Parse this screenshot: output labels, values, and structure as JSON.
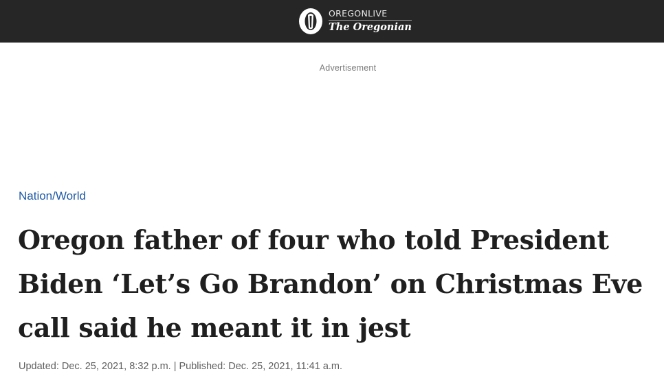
{
  "header": {
    "site_name": "OREGONLIVE",
    "paper_name": "The Oregonian",
    "logo_icon": "oregonian-o-icon",
    "background_color": "#262626"
  },
  "ad": {
    "label": "Advertisement"
  },
  "article": {
    "section": "Nation/World",
    "section_color": "#1e5aa6",
    "headline": "Oregon father of four who told President Biden ‘Let’s Go Brandon’ on Christmas Eve call said he meant it in jest",
    "dateline": "Updated: Dec. 25, 2021, 8:32 p.m. | Published: Dec. 25, 2021, 11:41 a.m."
  }
}
